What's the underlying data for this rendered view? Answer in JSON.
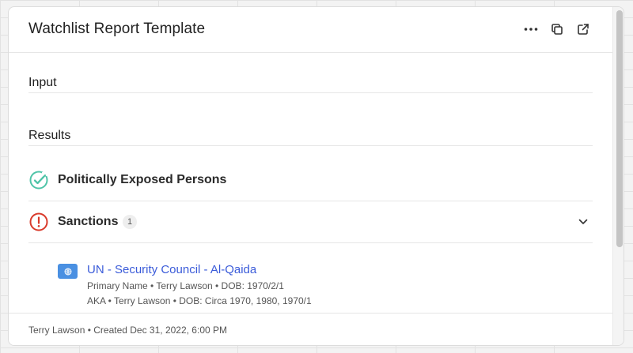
{
  "card": {
    "title": "Watchlist Report Template"
  },
  "header_actions": [
    {
      "icon": "more-horizontal-icon"
    },
    {
      "icon": "copy-icon"
    },
    {
      "icon": "open-external-icon"
    }
  ],
  "sections": {
    "input_label": "Input",
    "results_label": "Results"
  },
  "results": {
    "pep": {
      "title": "Politically Exposed Persons",
      "status": "clear",
      "icon": "check-circle-icon",
      "color": "#4fc4a8"
    },
    "sanctions": {
      "title": "Sanctions",
      "count": "1",
      "status": "hit",
      "icon": "alert-circle-icon",
      "color": "#d93a2b",
      "hits": [
        {
          "list_name": "UN - Security Council - Al-Qaida",
          "primary": "Primary Name • Terry Lawson • DOB: 1970/2/1",
          "aka": "AKA • Terry Lawson • DOB: Circa 1970, 1980, 1970/1"
        }
      ]
    }
  },
  "footer": {
    "text": "Terry Lawson • Created Dec 31, 2022, 6:00 PM"
  },
  "colors": {
    "link": "#3a5bd9",
    "flag": "#4a90e2"
  }
}
